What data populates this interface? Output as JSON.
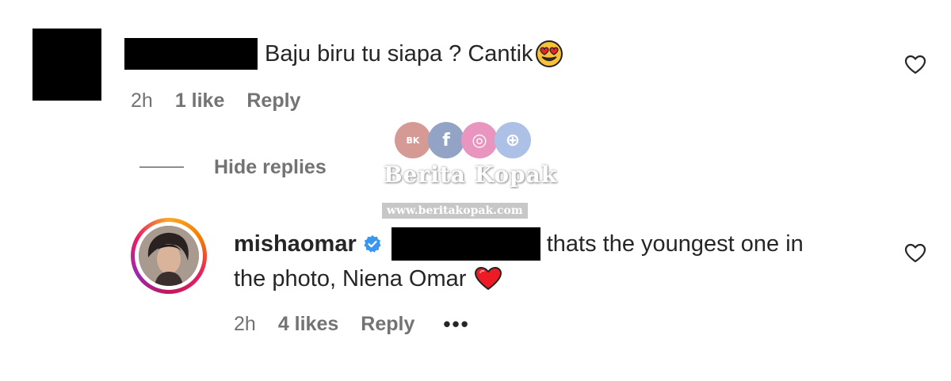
{
  "comment": {
    "text": "Baju biru tu siapa ? Cantik",
    "emoji": "heart-eyes-emoji",
    "time": "2h",
    "likes": "1 like",
    "reply_label": "Reply"
  },
  "thread": {
    "hide_replies_label": "Hide replies"
  },
  "watermark": {
    "title": "Berita Kopak",
    "url": "www.beritakopak.com",
    "badge": "BK"
  },
  "reply": {
    "username": "mishaomar",
    "line1": "thats the youngest one in",
    "line2": "the photo, Niena Omar",
    "time": "2h",
    "likes": "4 likes",
    "reply_label": "Reply",
    "more_label": "•••"
  },
  "colors": {
    "text": "#262626",
    "meta": "#737373",
    "verified": "#3897f0",
    "heart_red": "#ed1c24"
  }
}
